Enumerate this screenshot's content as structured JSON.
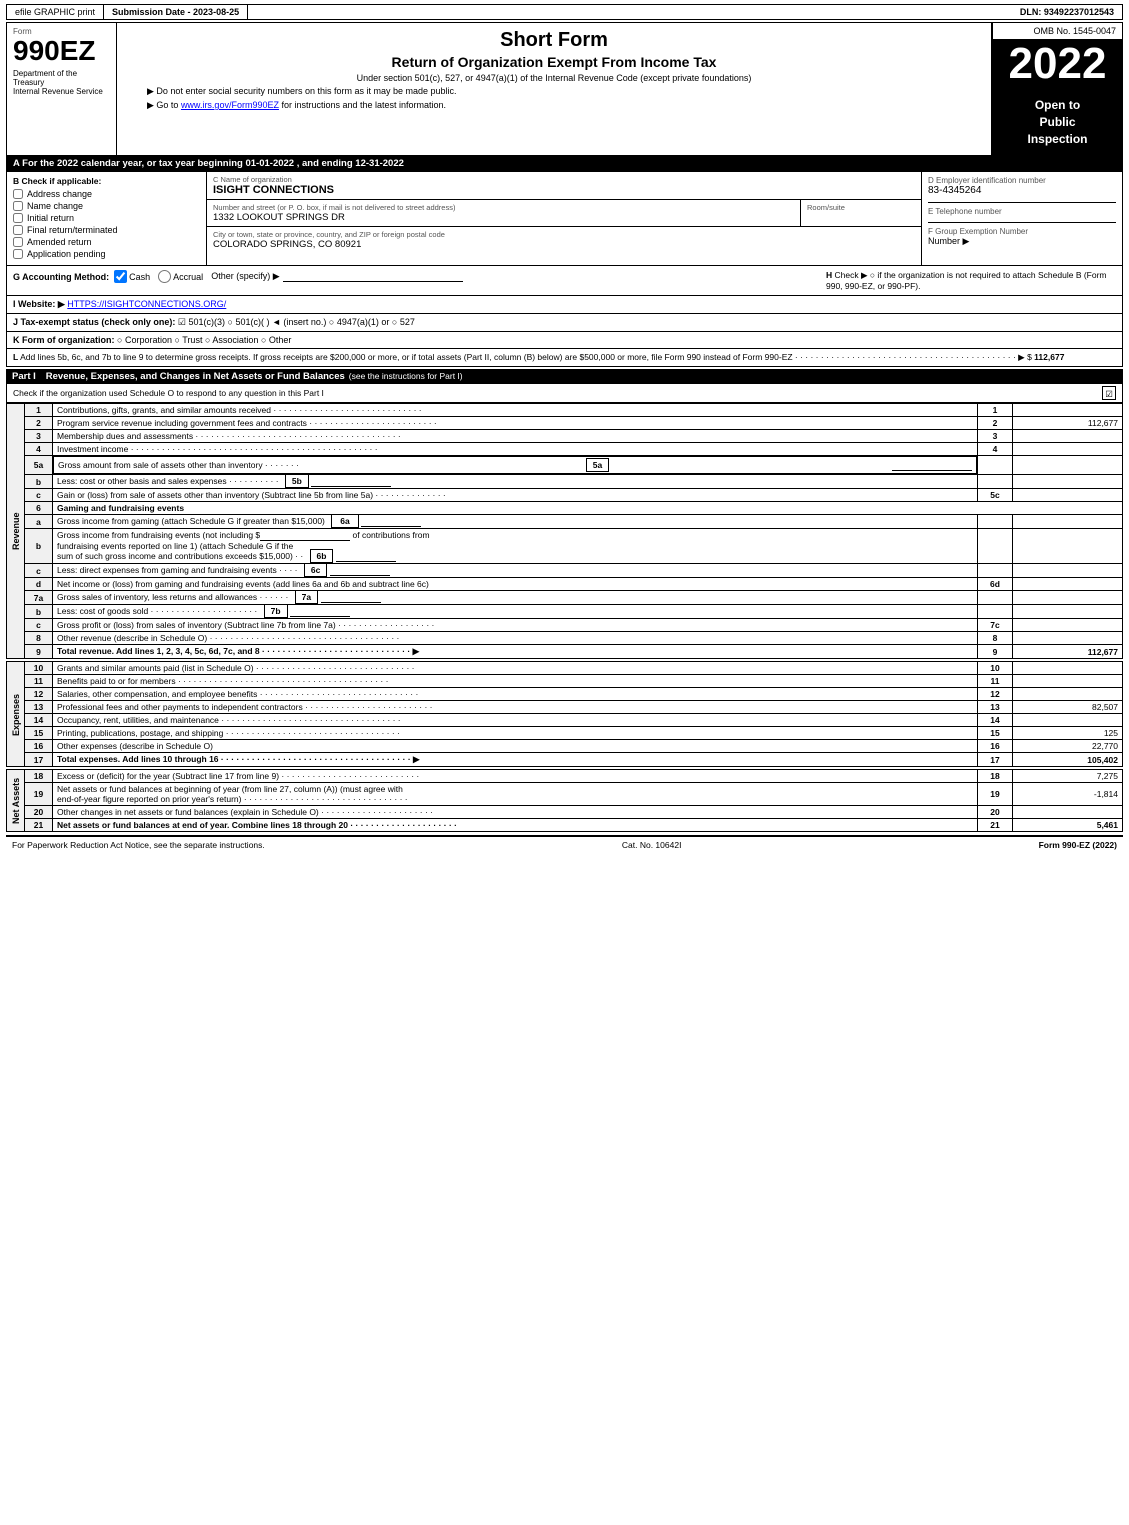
{
  "header": {
    "efile_label": "efile GRAPHIC print",
    "submission_label": "Submission Date - 2023-08-25",
    "dln_label": "DLN: 93492237012543"
  },
  "form": {
    "form_number": "990EZ",
    "department": "Department of the Treasury",
    "bureau": "Internal Revenue Service",
    "short_form_title": "Short Form",
    "main_title": "Return of Organization Exempt From Income Tax",
    "subtitle": "Under section 501(c), 527, or 4947(a)(1) of the Internal Revenue Code (except private foundations)",
    "instruction1": "▶ Do not enter social security numbers on this form as it may be made public.",
    "instruction2": "▶ Go to www.irs.gov/Form990EZ for instructions and the latest information.",
    "irs_url": "www.irs.gov/Form990EZ",
    "omb": "OMB No. 1545-0047",
    "year": "2022",
    "open_to_public": "Open to\nPublic\nInspection"
  },
  "section_a": {
    "header": "A For the 2022 calendar year, or tax year beginning 01-01-2022 , and ending 12-31-2022",
    "b_label": "B Check if applicable:",
    "checkboxes": {
      "address_change": "Address change",
      "name_change": "Name change",
      "initial_return": "Initial return",
      "final_return": "Final return/terminated",
      "amended_return": "Amended return",
      "application_pending": "Application pending"
    },
    "c_label": "C Name of organization",
    "org_name": "ISIGHT CONNECTIONS",
    "street_label": "Number and street (or P. O. box, if mail is not delivered to street address)",
    "street": "1332 LOOKOUT SPRINGS DR",
    "room_label": "Room/suite",
    "room": "",
    "city_label": "City or town, state or province, country, and ZIP or foreign postal code",
    "city": "COLORADO SPRINGS, CO  80921",
    "d_label": "D Employer identification number",
    "ein": "83-4345264",
    "e_label": "E Telephone number",
    "phone": "",
    "f_label": "F Group Exemption Number",
    "group_number": ""
  },
  "accounting": {
    "g_label": "G Accounting Method:",
    "cash_label": "Cash",
    "cash_checked": true,
    "accrual_label": "Accrual",
    "accrual_checked": false,
    "other_label": "Other (specify) ▶",
    "h_label": "H Check ▶",
    "h_text": "○ if the organization is not required to attach Schedule B (Form 990, 990-EZ, or 990-PF)."
  },
  "website": {
    "i_label": "I Website: ▶",
    "url": "HTTPS://ISIGHTCONNECTIONS.ORG/"
  },
  "tax_status": {
    "j_label": "J Tax-exempt status (check only one):",
    "options": [
      "☑ 501(c)(3)",
      "○ 501(c)(  ) ◄ (insert no.)",
      "○ 4947(a)(1) or",
      "○ 527"
    ]
  },
  "form_org": {
    "k_label": "K Form of organization:",
    "options": [
      "○ Corporation",
      "○ Trust",
      "○ Association",
      "○ Other"
    ]
  },
  "l_row": {
    "text": "L Add lines 5b, 6c, and 7b to line 9 to determine gross receipts. If gross receipts are $200,000 or more, or if total assets (Part II, column (B) below) are $500,000 or more, file Form 990 instead of Form 990-EZ",
    "dots": "· · · · · · · · · · · · · · · · · · · · · · · · · · · · · · · · · · · ·",
    "arrow": "▶ $",
    "amount": "112,677"
  },
  "part1": {
    "label": "Part I",
    "title": "Revenue, Expenses, and Changes in Net Assets or Fund Balances",
    "see_instructions": "(see the instructions for Part I)",
    "schedule_o_text": "Check if the organization used Schedule O to respond to any question in this Part I",
    "rows": [
      {
        "num": "1",
        "label": "Contributions, gifts, grants, and similar amounts received",
        "dots": true,
        "line": "1",
        "amount": ""
      },
      {
        "num": "2",
        "label": "Program service revenue including government fees and contracts",
        "dots": true,
        "line": "2",
        "amount": "112,677"
      },
      {
        "num": "3",
        "label": "Membership dues and assessments",
        "dots": true,
        "line": "3",
        "amount": ""
      },
      {
        "num": "4",
        "label": "Investment income",
        "dots": true,
        "line": "4",
        "amount": ""
      },
      {
        "num": "5a",
        "label": "Gross amount from sale of assets other than inventory",
        "sub": "5a",
        "amount": ""
      },
      {
        "num": "5b",
        "label": "Less: cost or other basis and sales expenses",
        "sub": "5b",
        "amount": ""
      },
      {
        "num": "5c",
        "label": "Gain or (loss) from sale of assets other than inventory (Subtract line 5b from line 5a)",
        "dots": true,
        "line": "5c",
        "amount": ""
      },
      {
        "num": "6",
        "label": "Gaming and fundraising events",
        "header": true
      },
      {
        "num": "6a",
        "label": "Gross income from gaming (attach Schedule G if greater than $15,000)",
        "sub": "6a",
        "amount": ""
      },
      {
        "num": "6b",
        "label": "Gross income from fundraising events (not including $______ of contributions from fundraising events reported on line 1) (attach Schedule G if the sum of such gross income and contributions exceeds $15,000)",
        "sub": "6b",
        "amount": ""
      },
      {
        "num": "6c",
        "label": "Less: direct expenses from gaming and fundraising events",
        "sub": "6c",
        "amount": ""
      },
      {
        "num": "6d",
        "label": "Net income or (loss) from gaming and fundraising events (add lines 6a and 6b and subtract line 6c)",
        "line": "6d",
        "amount": ""
      },
      {
        "num": "7a",
        "label": "Gross sales of inventory, less returns and allowances",
        "sub": "7a",
        "amount": ""
      },
      {
        "num": "7b",
        "label": "Less: cost of goods sold",
        "dots": true,
        "sub": "7b",
        "amount": ""
      },
      {
        "num": "7c",
        "label": "Gross profit or (loss) from sales of inventory (Subtract line 7b from line 7a)",
        "dots": true,
        "line": "7c",
        "amount": ""
      },
      {
        "num": "8",
        "label": "Other revenue (describe in Schedule O)",
        "dots": true,
        "line": "8",
        "amount": ""
      },
      {
        "num": "9",
        "label": "Total revenue. Add lines 1, 2, 3, 4, 5c, 6d, 7c, and 8",
        "dots": true,
        "arrow": true,
        "line": "9",
        "amount": "112,677",
        "bold": true
      }
    ],
    "revenue_side": "Revenue"
  },
  "expenses_rows": [
    {
      "num": "10",
      "label": "Grants and similar amounts paid (list in Schedule O)",
      "dots": true,
      "line": "10",
      "amount": ""
    },
    {
      "num": "11",
      "label": "Benefits paid to or for members",
      "dots": true,
      "line": "11",
      "amount": ""
    },
    {
      "num": "12",
      "label": "Salaries, other compensation, and employee benefits",
      "dots": true,
      "line": "12",
      "amount": ""
    },
    {
      "num": "13",
      "label": "Professional fees and other payments to independent contractors",
      "dots": true,
      "line": "13",
      "amount": "82,507"
    },
    {
      "num": "14",
      "label": "Occupancy, rent, utilities, and maintenance",
      "dots": true,
      "line": "14",
      "amount": ""
    },
    {
      "num": "15",
      "label": "Printing, publications, postage, and shipping",
      "dots": true,
      "line": "15",
      "amount": "125"
    },
    {
      "num": "16",
      "label": "Other expenses (describe in Schedule O)",
      "line": "16",
      "amount": "22,770"
    },
    {
      "num": "17",
      "label": "Total expenses. Add lines 10 through 16",
      "dots": true,
      "arrow": true,
      "line": "17",
      "amount": "105,402",
      "bold": true
    }
  ],
  "net_assets_rows": [
    {
      "num": "18",
      "label": "Excess or (deficit) for the year (Subtract line 17 from line 9)",
      "dots": true,
      "line": "18",
      "amount": "7,275"
    },
    {
      "num": "19",
      "label": "Net assets or fund balances at beginning of year (from line 27, column (A)) (must agree with end-of-year figure reported on prior year's return)",
      "dots": true,
      "line": "19",
      "amount": "-1,814"
    },
    {
      "num": "20",
      "label": "Other changes in net assets or fund balances (explain in Schedule O)",
      "dots": true,
      "line": "20",
      "amount": ""
    },
    {
      "num": "21",
      "label": "Net assets or fund balances at end of year. Combine lines 18 through 20",
      "dots": true,
      "line": "21",
      "amount": "5,461",
      "bold": true
    }
  ],
  "footer": {
    "paperwork_text": "For Paperwork Reduction Act Notice, see the separate instructions.",
    "cat_no": "Cat. No. 10642I",
    "form_label": "Form 990-EZ (2022)"
  }
}
